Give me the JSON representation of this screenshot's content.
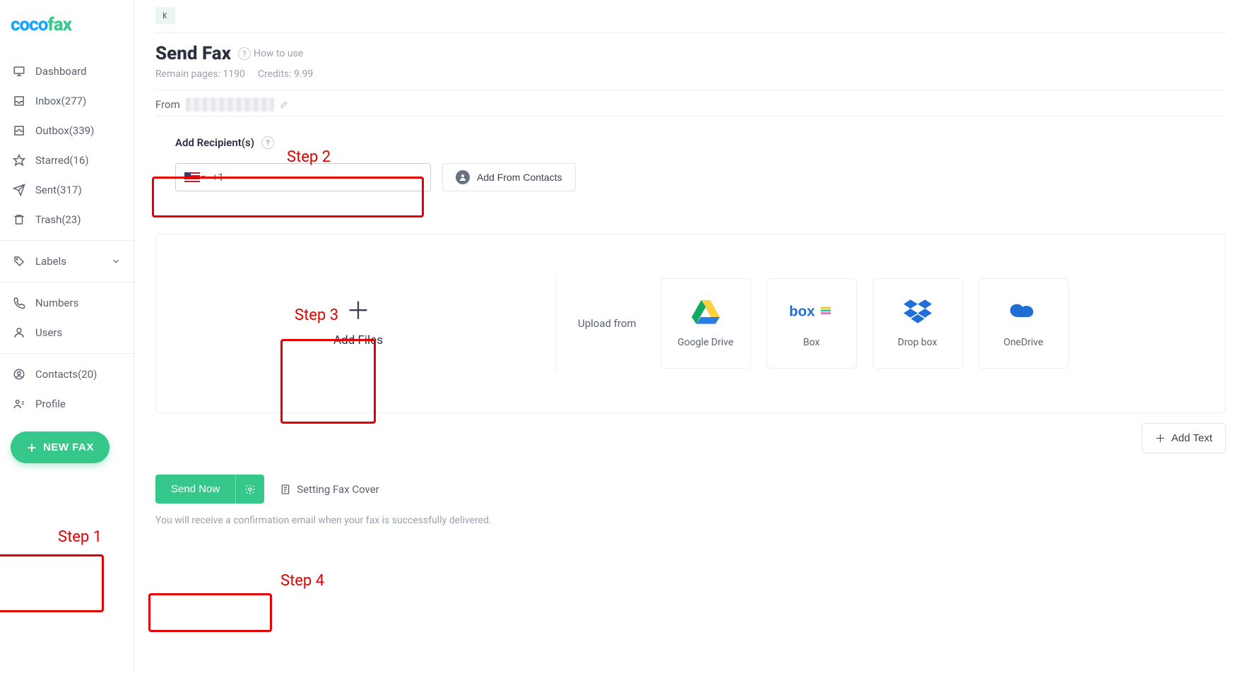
{
  "logo": {
    "part1": "coco",
    "part2": "fax"
  },
  "sidebar": {
    "items": [
      {
        "label": "Dashboard"
      },
      {
        "label": "Inbox(277)"
      },
      {
        "label": "Outbox(339)"
      },
      {
        "label": "Starred(16)"
      },
      {
        "label": "Sent(317)"
      },
      {
        "label": "Trash(23)"
      },
      {
        "label": "Labels"
      },
      {
        "label": "Numbers"
      },
      {
        "label": "Users"
      },
      {
        "label": "Contacts(20)"
      },
      {
        "label": "Profile"
      }
    ],
    "new_fax": "NEW FAX"
  },
  "header": {
    "title": "Send Fax",
    "how_to_use": "How to use",
    "remain_pages_label": "Remain pages: 1190",
    "credits_label": "Credits: 9.99"
  },
  "from": {
    "label": "From"
  },
  "recipients": {
    "label": "Add Recipient(s)",
    "dial": "+1",
    "add_from_contacts": "Add From Contacts"
  },
  "files": {
    "add_files": "Add Files",
    "upload_from": "Upload from",
    "sources": {
      "gdrive": "Google Drive",
      "box": "Box",
      "dropbox": "Drop box",
      "onedrive": "OneDrive"
    }
  },
  "add_text": "Add Text",
  "send": {
    "send_now": "Send Now",
    "setting_cover": "Setting Fax Cover",
    "note": "You will receive a confirmation email when your fax is successfully delivered."
  },
  "annotations": {
    "step1": "Step 1",
    "step2": "Step 2",
    "step3": "Step 3",
    "step4": "Step 4"
  }
}
